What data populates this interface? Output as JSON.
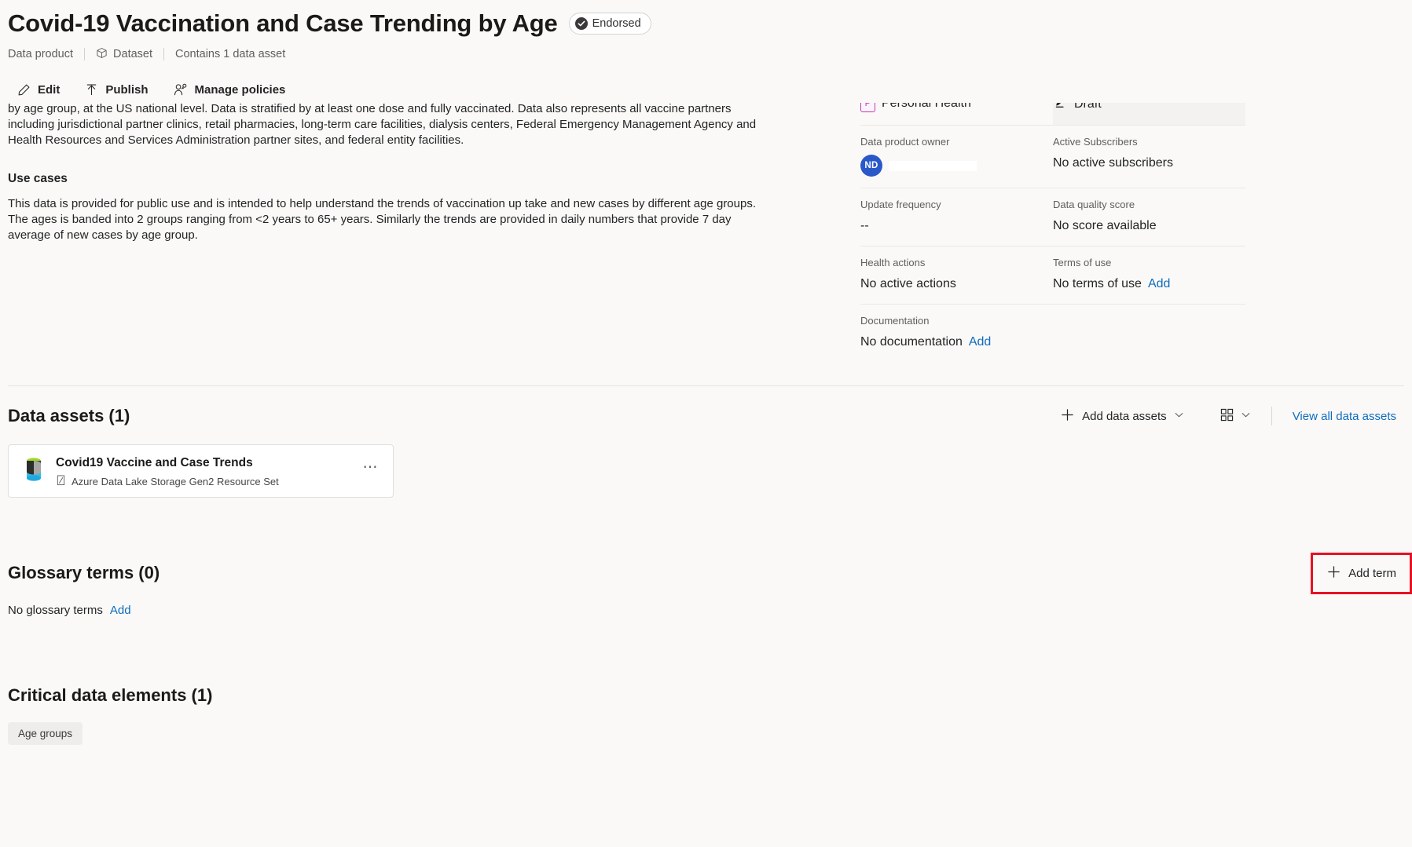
{
  "header": {
    "title": "Covid-19 Vaccination and Case Trending by Age",
    "endorsed_label": "Endorsed",
    "type_label": "Data product",
    "kind_label": "Dataset",
    "asset_count_label": "Contains 1 data asset"
  },
  "commandbar": {
    "edit": "Edit",
    "publish": "Publish",
    "manage_policies": "Manage policies"
  },
  "description": {
    "paragraph1": "This data comes from the CDC as a part of the U.S. Department of Health & Human Services.  The data contains trends in vaccinations and cases by age group, at the US national level. Data is stratified by at least one dose and fully vaccinated. Data also represents all vaccine partners including jurisdictional partner clinics, retail pharmacies, long-term care facilities, dialysis centers, Federal Emergency Management Agency and Health Resources and Services Administration partner sites, and federal entity facilities.",
    "use_cases_heading": "Use cases",
    "use_cases_text": "This data is provided for public use and is intended to help understand the trends of vaccination up take and new cases by different age groups.  The ages is banded into 2 groups ranging from <2 years to 65+ years.  Similarly the trends are provided in daily numbers that provide 7 day average of new cases by age group."
  },
  "metadata": {
    "label_value": "Personal Health",
    "label_badge_letter": "P",
    "status_value": "Draft",
    "owner_label": "Data product owner",
    "owner_initials": "ND",
    "subscribers_label": "Active Subscribers",
    "subscribers_value": "No active subscribers",
    "update_frequency_label": "Update frequency",
    "update_frequency_value": "--",
    "quality_label": "Data quality score",
    "quality_value": "No score available",
    "health_label": "Health actions",
    "health_value": "No active actions",
    "terms_label": "Terms of use",
    "terms_value": "No terms of use",
    "terms_add": "Add",
    "documentation_label": "Documentation",
    "documentation_value": "No documentation",
    "documentation_add": "Add"
  },
  "data_assets": {
    "title": "Data assets (1)",
    "add_label": "Add data assets",
    "view_all_label": "View all data assets",
    "asset_name": "Covid19 Vaccine and Case Trends",
    "asset_type": "Azure Data Lake Storage Gen2 Resource Set"
  },
  "glossary": {
    "title": "Glossary terms (0)",
    "empty_text": "No glossary terms",
    "add_link": "Add",
    "add_term_button": "Add term"
  },
  "critical_data_elements": {
    "title": "Critical data elements (1)",
    "items": [
      "Age groups"
    ]
  },
  "colors": {
    "accent_link": "#0f6cbd",
    "highlight": "#e81123",
    "label_pink": "#c239b3",
    "avatar_blue": "#2b58c9",
    "page_background": "#faf9f8"
  }
}
